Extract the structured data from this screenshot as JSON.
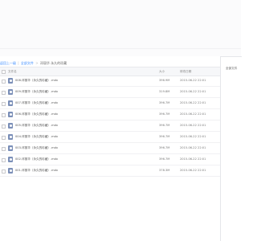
{
  "breadcrumb": {
    "back": "返回上一级",
    "sep1": "|",
    "root": "全部文件",
    "sep2": ">",
    "current": "邓丽华 永久的珍藏"
  },
  "table_header": {
    "name": "文件名",
    "size": "大小",
    "date": "修改日期"
  },
  "files": [
    {
      "name": "008.邓丽华（永久的珍藏）.mdx",
      "size": "396.9M",
      "date": "2015-06-22 22:01"
    },
    {
      "name": "009.邓丽华（永久的珍藏）.mdx",
      "size": "319.8M",
      "date": "2015-06-22 22:01"
    },
    {
      "name": "007.邓丽华（永久的珍藏）.mdx",
      "size": "396.7M",
      "date": "2015-06-22 22:01"
    },
    {
      "name": "006.邓丽华（永久的珍藏）.mdx",
      "size": "396.7M",
      "date": "2015-06-22 22:01"
    },
    {
      "name": "005.邓丽华（永久的珍藏）.mdx",
      "size": "396.7M",
      "date": "2015-06-22 22:01"
    },
    {
      "name": "004.邓丽华（永久的珍藏）.mdx",
      "size": "396.7M",
      "date": "2015-06-22 22:01"
    },
    {
      "name": "003.邓丽华（永久的珍藏）.mdx",
      "size": "396.7M",
      "date": "2015-06-22 22:01"
    },
    {
      "name": "002.邓丽华（永久的珍藏）.mdx",
      "size": "396.7M",
      "date": "2015-06-22 22:01"
    },
    {
      "name": "001.邓丽华（永久的珍藏）.mdx",
      "size": "378.3M",
      "date": "2015-06-22 22:01"
    }
  ],
  "side_panel": {
    "title": "全部文件"
  },
  "colors": {
    "link": "#3b8cff",
    "file_icon": "#7b8fb8",
    "header_bg": "#f6f7f9"
  }
}
